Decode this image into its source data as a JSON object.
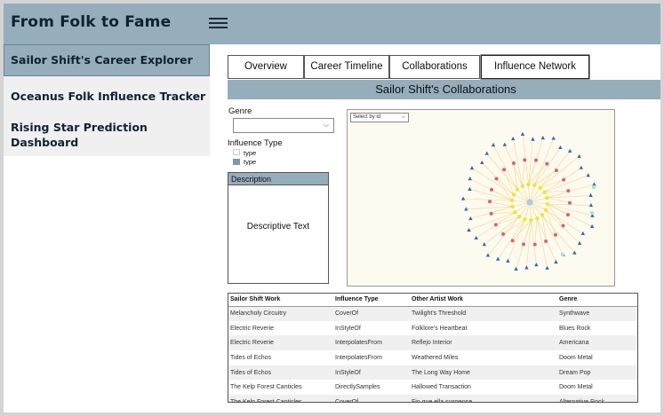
{
  "app": {
    "title": "From Folk to Fame"
  },
  "sidebar": {
    "items": [
      {
        "label": "Sailor Shift's Career Explorer"
      },
      {
        "label": "Oceanus Folk Influence Tracker"
      },
      {
        "label": "Rising Star Prediction Dashboard"
      }
    ]
  },
  "tabs": [
    {
      "label": "Overview"
    },
    {
      "label": "Career Timeline"
    },
    {
      "label": "Collaborations"
    },
    {
      "label": "Influence Network"
    }
  ],
  "section": {
    "title": "Sailor Shift's Collaborations"
  },
  "filters": {
    "genre_label": "Genre",
    "genre_value": "",
    "influence_type_label": "Influence Type",
    "legend": [
      {
        "label": "type",
        "color": "#ffffff"
      },
      {
        "label": "type",
        "color": "#7f97a8"
      }
    ]
  },
  "description": {
    "header": "Description",
    "text": "Descriptive Text"
  },
  "network": {
    "select_label": "Select by id",
    "colors": {
      "center": "#a9c9ee",
      "edge": "#f3d78a",
      "yellow": "#f2e33a",
      "red": "#e0606a",
      "blue": "#2f6cb0",
      "teal": "#9fe8d8"
    }
  },
  "table": {
    "columns": [
      "Sailor Shift Work",
      "Influence Type",
      "Other Artist Work",
      "Genre"
    ],
    "rows": [
      [
        "Melancholy Circuitry",
        "CoverOf",
        "Twilight's Threshold",
        "Synthwave"
      ],
      [
        "Electric Reverie",
        "InStyleOf",
        "Folklore's Heartbeat",
        "Blues Rock"
      ],
      [
        "Electric Reverie",
        "InterpolatesFrom",
        "Reflejo Interior",
        "Americana"
      ],
      [
        "Tides of Echos",
        "InterpolatesFrom",
        "Weathered Miles",
        "Doom Metal"
      ],
      [
        "Tides of Echos",
        "InStyleOf",
        "The Long Way Home",
        "Dream Pop"
      ],
      [
        "The Kelp Forest Canticles",
        "DirectlySamples",
        "Hallowed Transaction",
        "Doom Metal"
      ],
      [
        "The Kelp Forest Canticles",
        "CoverOf",
        "Fin que ella suspense",
        "Alternative Rock"
      ]
    ]
  }
}
